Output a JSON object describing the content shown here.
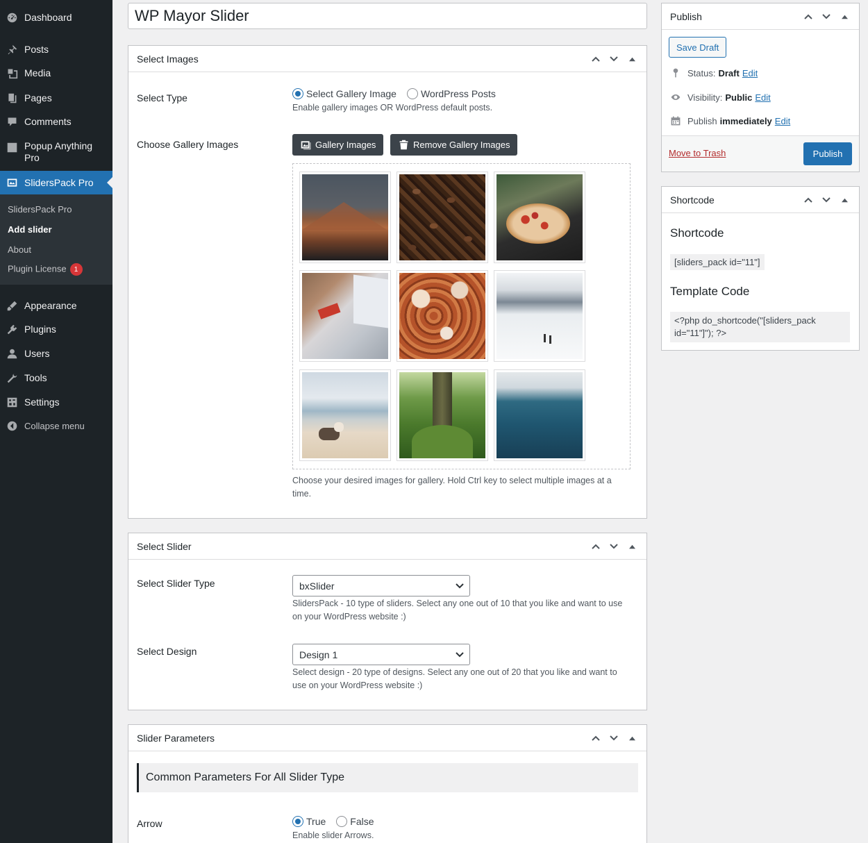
{
  "sidebar": {
    "items": [
      {
        "label": "Dashboard",
        "icon": "dashboard-icon"
      },
      {
        "label": "Posts",
        "icon": "pin-icon"
      },
      {
        "label": "Media",
        "icon": "media-icon"
      },
      {
        "label": "Pages",
        "icon": "pages-icon"
      },
      {
        "label": "Comments",
        "icon": "comments-icon"
      },
      {
        "label": "Popup Anything Pro",
        "icon": "popup-icon"
      },
      {
        "label": "SlidersPack Pro",
        "icon": "sliderspack-icon"
      },
      {
        "label": "Appearance",
        "icon": "appearance-icon"
      },
      {
        "label": "Plugins",
        "icon": "plugins-icon"
      },
      {
        "label": "Users",
        "icon": "users-icon"
      },
      {
        "label": "Tools",
        "icon": "tools-icon"
      },
      {
        "label": "Settings",
        "icon": "settings-icon"
      }
    ],
    "popup_line1": "Popup Anything",
    "popup_line2": "Pro",
    "submenu": [
      "SlidersPack Pro",
      "Add slider",
      "About",
      "Plugin License"
    ],
    "license_badge": "1",
    "collapse_label": "Collapse menu",
    "accent": "#2271b1"
  },
  "post_title": "WP Mayor Slider",
  "select_images": {
    "heading": "Select Images",
    "select_type_label": "Select Type",
    "option_gallery": "Select Gallery Image",
    "option_posts": "WordPress Posts",
    "select_type_desc": "Enable gallery images OR WordPress default posts.",
    "choose_label": "Choose Gallery Images",
    "gallery_button": "Gallery Images",
    "remove_button": "Remove Gallery Images",
    "gallery_desc": "Choose your desired images for gallery. Hold Ctrl key to select multiple images at a time.",
    "images": [
      "mountain-photo",
      "coffee-beans-photo",
      "pizza-photo",
      "laptop-card-photo",
      "autumn-leaves-photo",
      "snow-slope-photo",
      "beach-dog-photo",
      "mossy-tree-photo",
      "ocean-photo"
    ]
  },
  "select_slider": {
    "heading": "Select Slider",
    "type_label": "Select Slider Type",
    "type_value": "bxSlider",
    "type_desc": "SlidersPack - 10 type of sliders. Select any one out of 10 that you like and want to use on your WordPress website :)",
    "design_label": "Select Design",
    "design_value": "Design 1",
    "design_desc": "Select design - 20 type of designs. Select any one out of 20 that you like and want to use on your WordPress website :)"
  },
  "slider_params": {
    "heading": "Slider Parameters",
    "subheading": "Common Parameters For All Slider Type",
    "arrow_label": "Arrow",
    "true_label": "True",
    "false_label": "False",
    "arrow_desc": "Enable slider Arrows."
  },
  "publish": {
    "heading": "Publish",
    "save_draft": "Save Draft",
    "status_label": "Status:",
    "status_value": "Draft",
    "visibility_label": "Visibility:",
    "visibility_value": "Public",
    "publish_label": "Publish",
    "publish_value": "immediately",
    "edit": "Edit",
    "trash": "Move to Trash",
    "publish_button": "Publish"
  },
  "shortcode": {
    "heading": "Shortcode",
    "title": "Shortcode",
    "code": "[sliders_pack id=\"11\"]",
    "template_title": "Template Code",
    "template_line1": "<?php do_shortcode(\"[sliders_pack",
    "template_line2": "id=\"11\"]\"); ?>"
  }
}
